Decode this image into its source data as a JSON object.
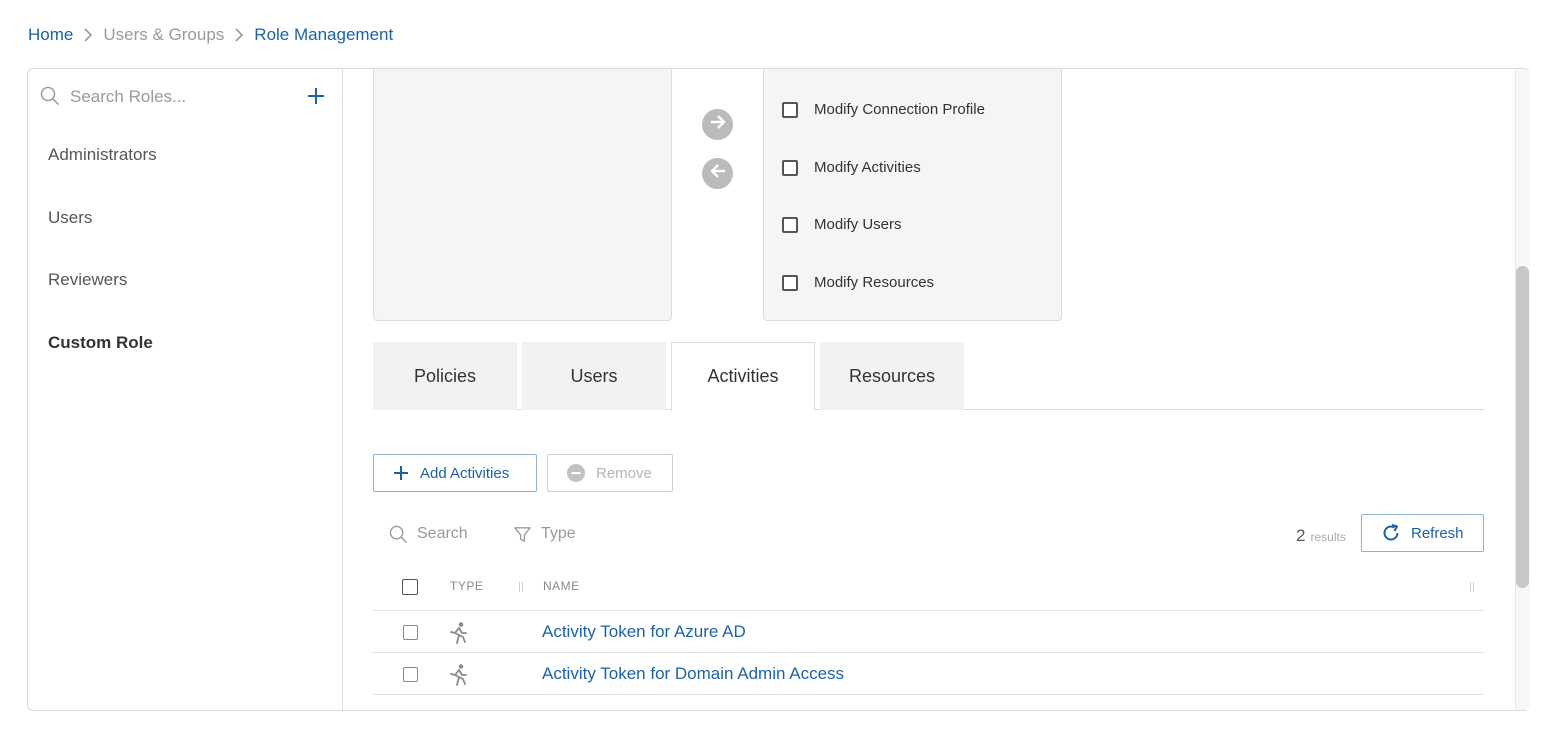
{
  "breadcrumb": {
    "home": "Home",
    "users_groups": "Users & Groups",
    "current": "Role Management"
  },
  "sidebar": {
    "search_placeholder": "Search Roles...",
    "roles": [
      {
        "label": "Administrators",
        "active": false
      },
      {
        "label": "Users",
        "active": false
      },
      {
        "label": "Reviewers",
        "active": false
      },
      {
        "label": "Custom Role",
        "active": true
      }
    ]
  },
  "permissions": {
    "available": [
      {
        "label": "Modify Connection Profile",
        "checked": false
      },
      {
        "label": "Modify Activities",
        "checked": false
      },
      {
        "label": "Modify Users",
        "checked": false
      },
      {
        "label": "Modify Resources",
        "checked": false
      }
    ]
  },
  "tabs": [
    {
      "label": "Policies",
      "active": false
    },
    {
      "label": "Users",
      "active": false
    },
    {
      "label": "Activities",
      "active": true
    },
    {
      "label": "Resources",
      "active": false
    }
  ],
  "toolbar": {
    "add_label": "Add Activities",
    "remove_label": "Remove"
  },
  "filters": {
    "search_label": "Search",
    "type_label": "Type",
    "results_count": "2",
    "results_label": "results",
    "refresh_label": "Refresh"
  },
  "table": {
    "columns": [
      "TYPE",
      "NAME"
    ],
    "rows": [
      {
        "type_icon": "running-person-icon",
        "name": "Activity Token for Azure AD"
      },
      {
        "type_icon": "running-person-icon",
        "name": "Activity Token for Domain Admin Access"
      }
    ]
  },
  "colors": {
    "link_blue": "#1a63a8",
    "panel_bg": "#f4f5f6",
    "muted_text": "#9a9a9a"
  }
}
